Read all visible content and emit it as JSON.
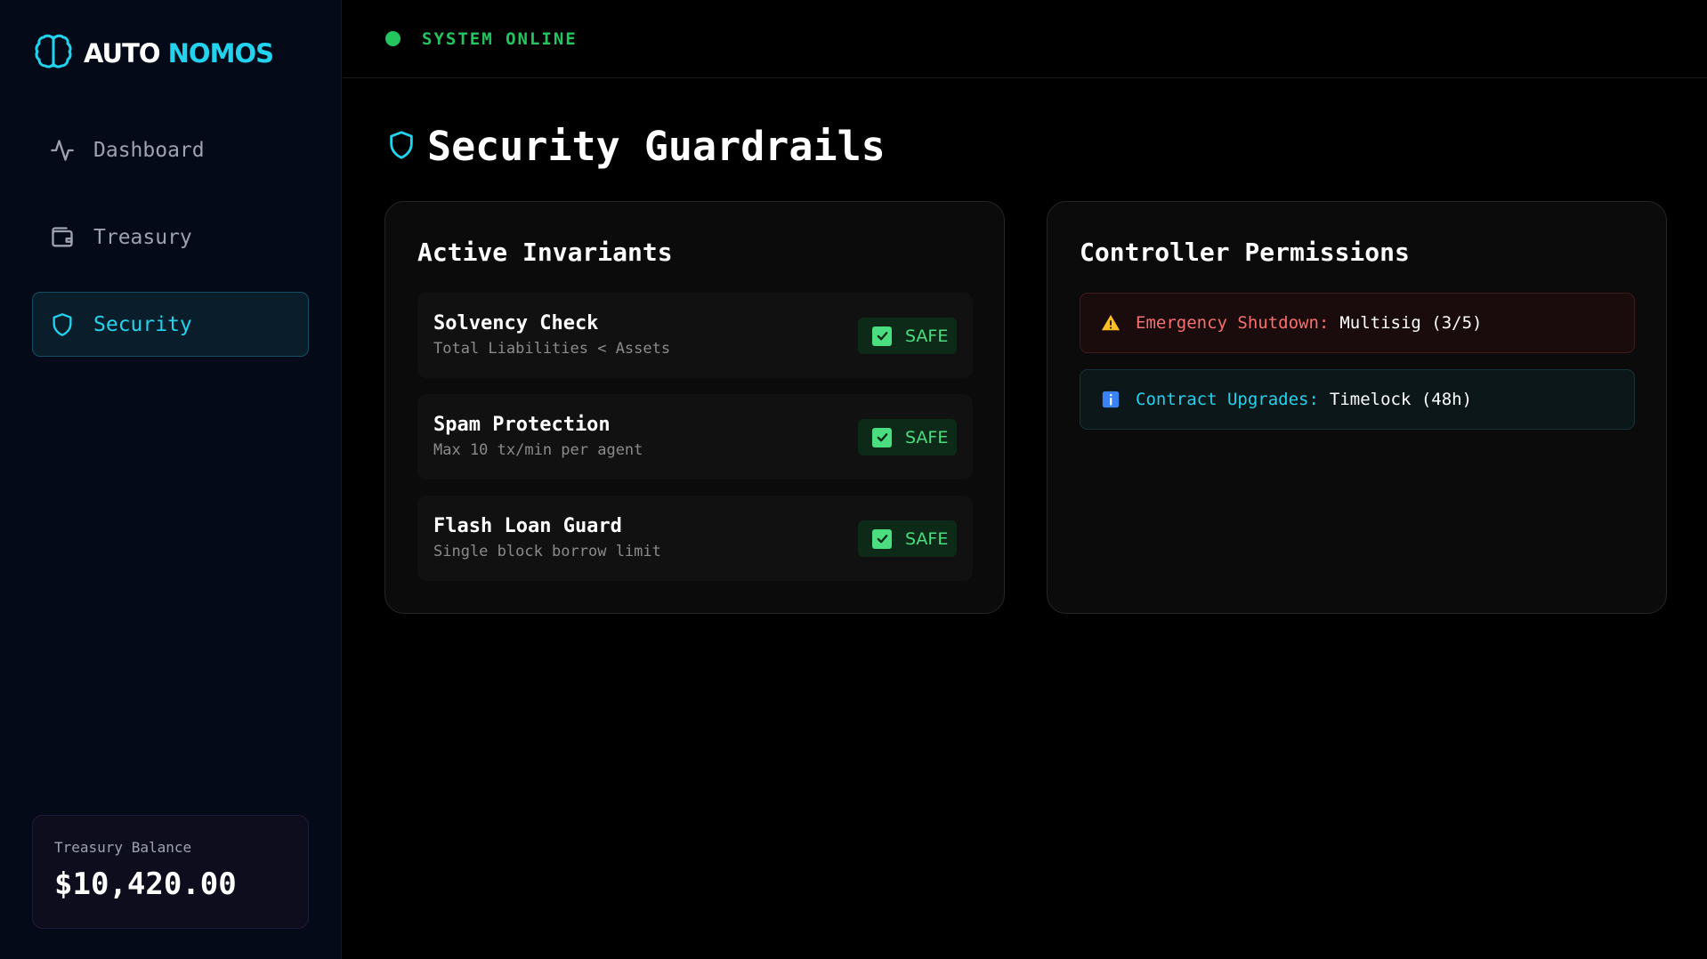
{
  "brand": {
    "part1": "AUTO",
    "part2": "NOMOS",
    "icon": "brain-icon",
    "accent": "#22d3ee"
  },
  "sidebar": {
    "items": [
      {
        "label": "Dashboard",
        "icon": "activity-icon",
        "active": false
      },
      {
        "label": "Treasury",
        "icon": "wallet-icon",
        "active": false
      },
      {
        "label": "Security",
        "icon": "shield-icon",
        "active": true
      }
    ],
    "balance": {
      "label": "Treasury Balance",
      "value": "$10,420.00"
    }
  },
  "topbar": {
    "status": "SYSTEM ONLINE",
    "status_color": "#22c55e"
  },
  "main": {
    "title": "Security Guardrails",
    "title_icon": "shield-icon",
    "invariants": {
      "title": "Active Invariants",
      "items": [
        {
          "name": "Solvency Check",
          "desc": "Total Liabilities < Assets",
          "status": "SAFE"
        },
        {
          "name": "Spam Protection",
          "desc": "Max 10 tx/min per agent",
          "status": "SAFE"
        },
        {
          "name": "Flash Loan Guard",
          "desc": "Single block borrow limit",
          "status": "SAFE"
        }
      ]
    },
    "permissions": {
      "title": "Controller Permissions",
      "items": [
        {
          "label": "Emergency Shutdown:",
          "value": "Multisig (3/5)",
          "icon": "warning-icon",
          "level": "danger"
        },
        {
          "label": "Contract Upgrades:",
          "value": "Timelock (48h)",
          "icon": "info-icon",
          "level": "info"
        }
      ]
    }
  }
}
